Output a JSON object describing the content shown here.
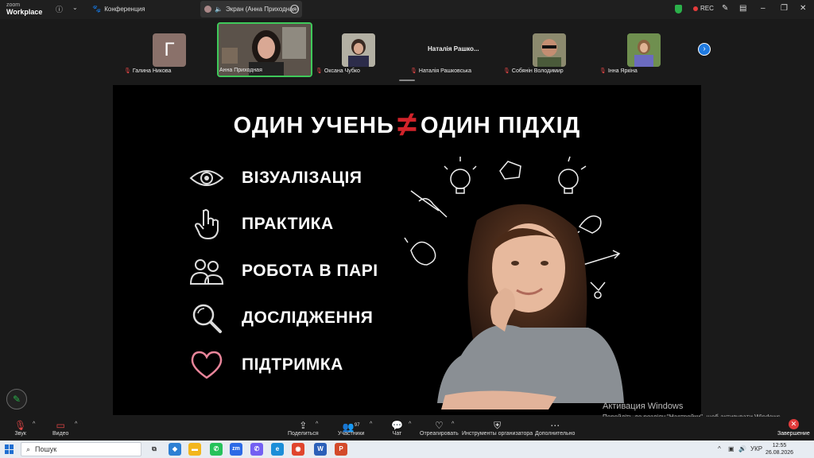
{
  "topbar": {
    "logo_line1": "zoom",
    "logo_line2": "Workplace",
    "conference_label": "Конференция",
    "screen_share_label": "Экран (Анна Приходная)",
    "rec_label": "REC"
  },
  "participants": [
    {
      "name": "Галина Никова",
      "initial": "Г"
    },
    {
      "name": "Анна Приходная"
    },
    {
      "name": "Оксана Чубко"
    },
    {
      "name": "Наталія Рашковська",
      "display": "Наталія Рашко..."
    },
    {
      "name": "Собянін Володимир"
    },
    {
      "name": "Інна Яркіна"
    }
  ],
  "slide": {
    "title_left": "ОДИН УЧЕНЬ",
    "title_sign": "≠",
    "title_right": "ОДИН ПІДХІД",
    "items": [
      {
        "label": "ВІЗУАЛІЗАЦІЯ",
        "icon": "eye-icon"
      },
      {
        "label": "ПРАКТИКА",
        "icon": "pointer-hand-icon"
      },
      {
        "label": "РОБОТА В ПАРІ",
        "icon": "people-icon"
      },
      {
        "label": "ДОСЛІДЖЕННЯ",
        "icon": "magnifier-icon"
      },
      {
        "label": "ПІДТРИМКА",
        "icon": "heart-icon"
      }
    ],
    "accent_color": "#d1232a",
    "heart_color": "#e8859a"
  },
  "watermark": {
    "line1": "Активация Windows",
    "line2": "Перейдіть до розділу \"Настройки\", щоб активувати Windows."
  },
  "toolbar": {
    "audio": "Звук",
    "video": "Видео",
    "share": "Поделиться",
    "participants": "Участники",
    "participants_count": "97",
    "chat": "Чат",
    "react": "Отреагировать",
    "host_tools": "Инструменты организатора",
    "more": "Дополнительно",
    "end": "Завершение"
  },
  "taskbar": {
    "search_placeholder": "Пошук",
    "lang": "УКР",
    "time": "12:55",
    "date": "26.08.2026"
  }
}
